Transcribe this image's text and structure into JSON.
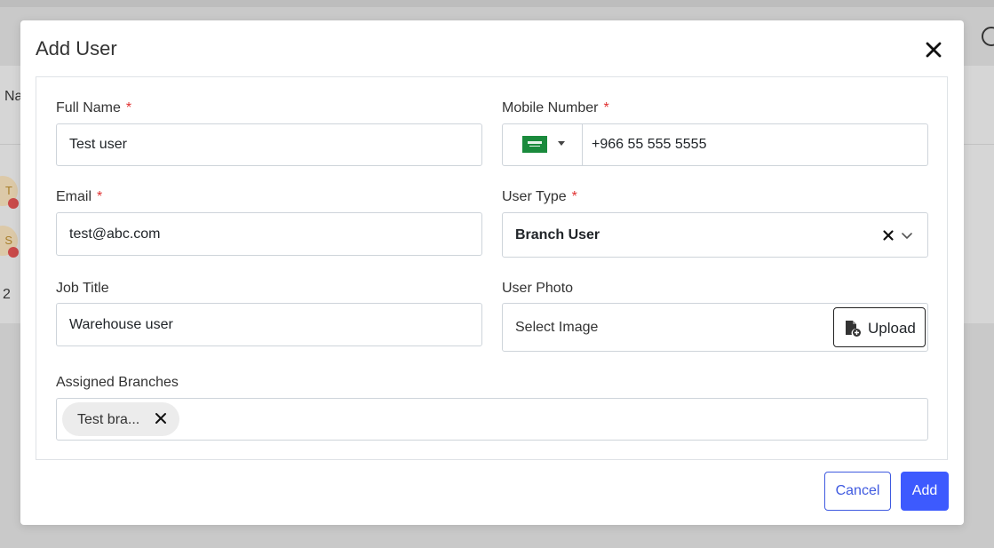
{
  "background": {
    "column_header_partial": "Na",
    "avatar_1_letter": "T",
    "avatar_2_letter": "S",
    "count_partial": "2"
  },
  "modal": {
    "title": "Add User",
    "fields": {
      "full_name": {
        "label": "Full Name",
        "required_mark": "*",
        "value": "Test user"
      },
      "mobile_number": {
        "label": "Mobile Number",
        "required_mark": "*",
        "country": "saudi-arabia-flag",
        "value": "+966 55 555 5555"
      },
      "email": {
        "label": "Email",
        "required_mark": "*",
        "value": "test@abc.com"
      },
      "user_type": {
        "label": "User Type",
        "required_mark": "*",
        "selected": "Branch User"
      },
      "job_title": {
        "label": "Job Title",
        "value": "Warehouse user"
      },
      "user_photo": {
        "label": "User Photo",
        "placeholder": "Select Image",
        "upload_label": "Upload"
      },
      "assigned_branches": {
        "label": "Assigned Branches",
        "chips": [
          "Test bra..."
        ]
      }
    },
    "actions": {
      "cancel_label": "Cancel",
      "add_label": "Add"
    }
  },
  "colors": {
    "primary": "#3d5afe",
    "required": "#e03131",
    "flag_green": "#1a8a3c"
  }
}
